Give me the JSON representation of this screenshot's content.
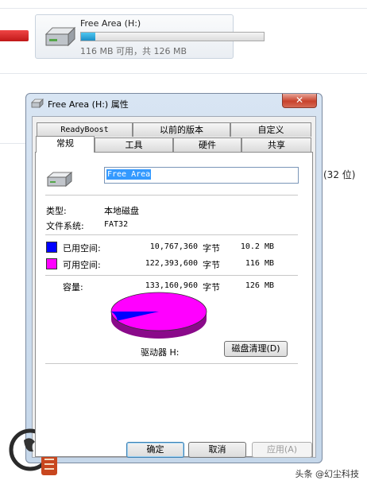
{
  "explorer": {
    "drive_name": "Free Area (H:)",
    "free_text": "116 MB 可用，共 126 MB",
    "used_fraction": 0.08,
    "side_text": "(32 位)"
  },
  "dialog": {
    "title": "Free Area (H:) 属性",
    "close_glyph": "✕",
    "tabs_row1": [
      "ReadyBoost",
      "以前的版本",
      "自定义"
    ],
    "tabs_row2": [
      "常规",
      "工具",
      "硬件",
      "共享"
    ],
    "active_tab": "常规",
    "volume_name": "Free Area",
    "type_label": "类型:",
    "type_value": "本地磁盘",
    "fs_label": "文件系统:",
    "fs_value": "FAT32",
    "used_label": "已用空间:",
    "used_bytes": "10,767,360",
    "used_unit": "字节",
    "used_size": "10.2 MB",
    "free_label": "可用空间:",
    "free_bytes": "122,393,600",
    "free_unit": "字节",
    "free_size": "116 MB",
    "capacity_label": "容量:",
    "capacity_bytes": "133,160,960",
    "capacity_unit": "字节",
    "capacity_size": "126 MB",
    "drive_label": "驱动器 H:",
    "cleanup_button": "磁盘清理(D)",
    "ok_button": "确定",
    "cancel_button": "取消",
    "apply_button": "应用(A)"
  },
  "colors": {
    "used": "#0000ff",
    "free": "#ff00ff"
  },
  "watermark": {
    "text": "头条 @幻尘科技"
  }
}
